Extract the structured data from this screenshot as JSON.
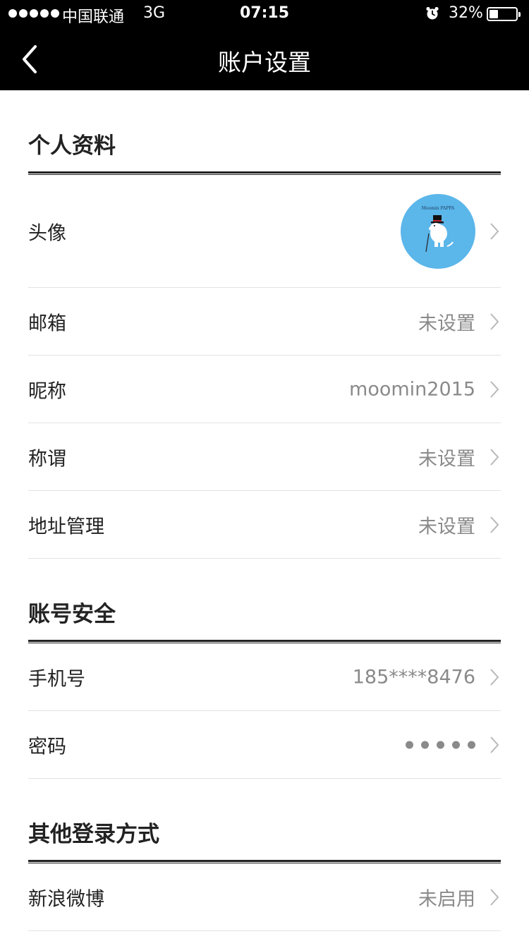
{
  "status_bar": {
    "carrier": "中国联通",
    "network": "3G",
    "time": "07:15",
    "battery_percent": "32%",
    "battery_level": 0.32
  },
  "nav": {
    "title": "账户设置",
    "back_icon": "chevron-left-icon"
  },
  "sections": {
    "profile": {
      "title": "个人资料",
      "avatar_label": "头像",
      "avatar_bg_color": "#5bb6ea",
      "avatar_text": "Moomin PAPPA",
      "email_label": "邮箱",
      "email_value": "未设置",
      "nickname_label": "昵称",
      "nickname_value": "moomin2015",
      "title_label": "称谓",
      "title_value": "未设置",
      "address_label": "地址管理",
      "address_value": "未设置"
    },
    "security": {
      "title": "账号安全",
      "phone_label": "手机号",
      "phone_value": "185****8476",
      "password_label": "密码",
      "password_mask_count": 5
    },
    "other_login": {
      "title": "其他登录方式",
      "weibo_label": "新浪微博",
      "weibo_value": "未启用"
    }
  },
  "colors": {
    "nav_background": "#000000",
    "value_text": "#8a8a8a",
    "divider": "#e2e2e2"
  }
}
